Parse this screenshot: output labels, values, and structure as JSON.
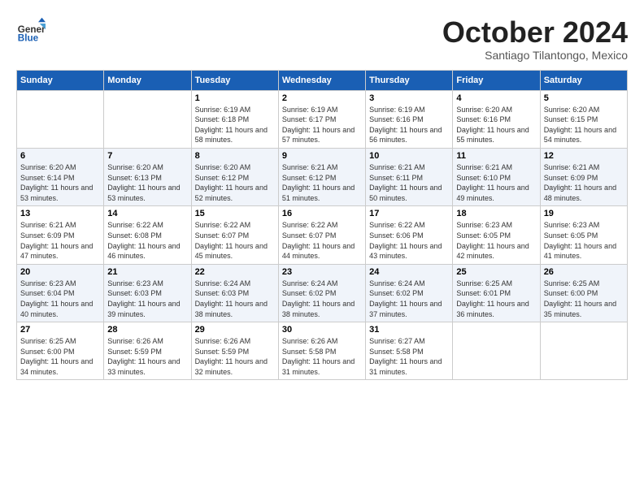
{
  "header": {
    "logo": {
      "general": "General",
      "blue": "Blue"
    },
    "title": "October 2024",
    "subtitle": "Santiago Tilantongo, Mexico"
  },
  "weekdays": [
    "Sunday",
    "Monday",
    "Tuesday",
    "Wednesday",
    "Thursday",
    "Friday",
    "Saturday"
  ],
  "weeks": [
    [
      {
        "day": null
      },
      {
        "day": null
      },
      {
        "day": "1",
        "sunrise": "6:19 AM",
        "sunset": "6:18 PM",
        "daylight": "11 hours and 58 minutes."
      },
      {
        "day": "2",
        "sunrise": "6:19 AM",
        "sunset": "6:17 PM",
        "daylight": "11 hours and 57 minutes."
      },
      {
        "day": "3",
        "sunrise": "6:19 AM",
        "sunset": "6:16 PM",
        "daylight": "11 hours and 56 minutes."
      },
      {
        "day": "4",
        "sunrise": "6:20 AM",
        "sunset": "6:16 PM",
        "daylight": "11 hours and 55 minutes."
      },
      {
        "day": "5",
        "sunrise": "6:20 AM",
        "sunset": "6:15 PM",
        "daylight": "11 hours and 54 minutes."
      }
    ],
    [
      {
        "day": "6",
        "sunrise": "6:20 AM",
        "sunset": "6:14 PM",
        "daylight": "11 hours and 53 minutes."
      },
      {
        "day": "7",
        "sunrise": "6:20 AM",
        "sunset": "6:13 PM",
        "daylight": "11 hours and 53 minutes."
      },
      {
        "day": "8",
        "sunrise": "6:20 AM",
        "sunset": "6:12 PM",
        "daylight": "11 hours and 52 minutes."
      },
      {
        "day": "9",
        "sunrise": "6:21 AM",
        "sunset": "6:12 PM",
        "daylight": "11 hours and 51 minutes."
      },
      {
        "day": "10",
        "sunrise": "6:21 AM",
        "sunset": "6:11 PM",
        "daylight": "11 hours and 50 minutes."
      },
      {
        "day": "11",
        "sunrise": "6:21 AM",
        "sunset": "6:10 PM",
        "daylight": "11 hours and 49 minutes."
      },
      {
        "day": "12",
        "sunrise": "6:21 AM",
        "sunset": "6:09 PM",
        "daylight": "11 hours and 48 minutes."
      }
    ],
    [
      {
        "day": "13",
        "sunrise": "6:21 AM",
        "sunset": "6:09 PM",
        "daylight": "11 hours and 47 minutes."
      },
      {
        "day": "14",
        "sunrise": "6:22 AM",
        "sunset": "6:08 PM",
        "daylight": "11 hours and 46 minutes."
      },
      {
        "day": "15",
        "sunrise": "6:22 AM",
        "sunset": "6:07 PM",
        "daylight": "11 hours and 45 minutes."
      },
      {
        "day": "16",
        "sunrise": "6:22 AM",
        "sunset": "6:07 PM",
        "daylight": "11 hours and 44 minutes."
      },
      {
        "day": "17",
        "sunrise": "6:22 AM",
        "sunset": "6:06 PM",
        "daylight": "11 hours and 43 minutes."
      },
      {
        "day": "18",
        "sunrise": "6:23 AM",
        "sunset": "6:05 PM",
        "daylight": "11 hours and 42 minutes."
      },
      {
        "day": "19",
        "sunrise": "6:23 AM",
        "sunset": "6:05 PM",
        "daylight": "11 hours and 41 minutes."
      }
    ],
    [
      {
        "day": "20",
        "sunrise": "6:23 AM",
        "sunset": "6:04 PM",
        "daylight": "11 hours and 40 minutes."
      },
      {
        "day": "21",
        "sunrise": "6:23 AM",
        "sunset": "6:03 PM",
        "daylight": "11 hours and 39 minutes."
      },
      {
        "day": "22",
        "sunrise": "6:24 AM",
        "sunset": "6:03 PM",
        "daylight": "11 hours and 38 minutes."
      },
      {
        "day": "23",
        "sunrise": "6:24 AM",
        "sunset": "6:02 PM",
        "daylight": "11 hours and 38 minutes."
      },
      {
        "day": "24",
        "sunrise": "6:24 AM",
        "sunset": "6:02 PM",
        "daylight": "11 hours and 37 minutes."
      },
      {
        "day": "25",
        "sunrise": "6:25 AM",
        "sunset": "6:01 PM",
        "daylight": "11 hours and 36 minutes."
      },
      {
        "day": "26",
        "sunrise": "6:25 AM",
        "sunset": "6:00 PM",
        "daylight": "11 hours and 35 minutes."
      }
    ],
    [
      {
        "day": "27",
        "sunrise": "6:25 AM",
        "sunset": "6:00 PM",
        "daylight": "11 hours and 34 minutes."
      },
      {
        "day": "28",
        "sunrise": "6:26 AM",
        "sunset": "5:59 PM",
        "daylight": "11 hours and 33 minutes."
      },
      {
        "day": "29",
        "sunrise": "6:26 AM",
        "sunset": "5:59 PM",
        "daylight": "11 hours and 32 minutes."
      },
      {
        "day": "30",
        "sunrise": "6:26 AM",
        "sunset": "5:58 PM",
        "daylight": "11 hours and 31 minutes."
      },
      {
        "day": "31",
        "sunrise": "6:27 AM",
        "sunset": "5:58 PM",
        "daylight": "11 hours and 31 minutes."
      },
      {
        "day": null
      },
      {
        "day": null
      }
    ]
  ]
}
